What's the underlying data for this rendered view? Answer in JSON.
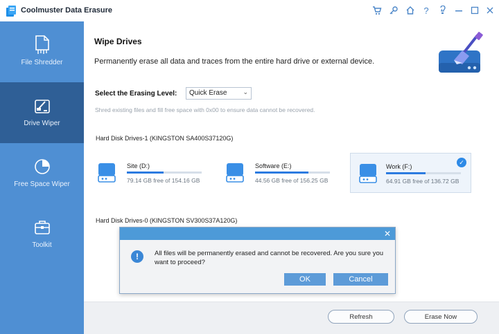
{
  "window": {
    "title": "Coolmuster Data Erasure"
  },
  "sidebar": {
    "items": [
      {
        "label": "File Shredder",
        "icon": "file-shredder-icon",
        "active": false
      },
      {
        "label": "Drive Wiper",
        "icon": "drive-wiper-icon",
        "active": true
      },
      {
        "label": "Free Space Wiper",
        "icon": "free-space-wiper-icon",
        "active": false
      },
      {
        "label": "Toolkit",
        "icon": "toolkit-icon",
        "active": false
      }
    ]
  },
  "main": {
    "title": "Wipe Drives",
    "description": "Permanently erase all data and traces from the entire hard drive or external device.",
    "erasing_level_label": "Select the Erasing Level:",
    "erasing_level_value": "Quick Erase",
    "erasing_level_hint": "Shred existing files and fill free space with 0x00 to ensure data cannot be recovered.",
    "disk_groups": [
      {
        "title": "Hard Disk Drives-1 (KINGSTON SA400S37120G)",
        "drives": [
          {
            "name": "Site (D:)",
            "free": "79.14 GB free of 154.16 GB",
            "used_fraction": 0.49,
            "selected": false
          },
          {
            "name": "Software (E:)",
            "free": "44.56 GB free of 156.25 GB",
            "used_fraction": 0.71,
            "selected": true
          },
          {
            "name": "Work (F:)",
            "free": "64.91 GB free of 136.72 GB",
            "used_fraction": 0.53,
            "selected": true
          }
        ]
      },
      {
        "title": "Hard Disk Drives-0 (KINGSTON SV300S37A120G)",
        "drives": []
      }
    ],
    "refresh_label": "Refresh",
    "erase_now_label": "Erase Now"
  },
  "dialog": {
    "message": "All files will be permanently erased and cannot be recovered. Are you sure you want to proceed?",
    "ok_label": "OK",
    "cancel_label": "Cancel"
  },
  "colors": {
    "sidebar": "#4f8fd3",
    "sidebar_active": "#2f5f96",
    "accent": "#2c7be0",
    "dialog_header": "#4d9ad8",
    "dialog_button": "#5d9bd8"
  }
}
